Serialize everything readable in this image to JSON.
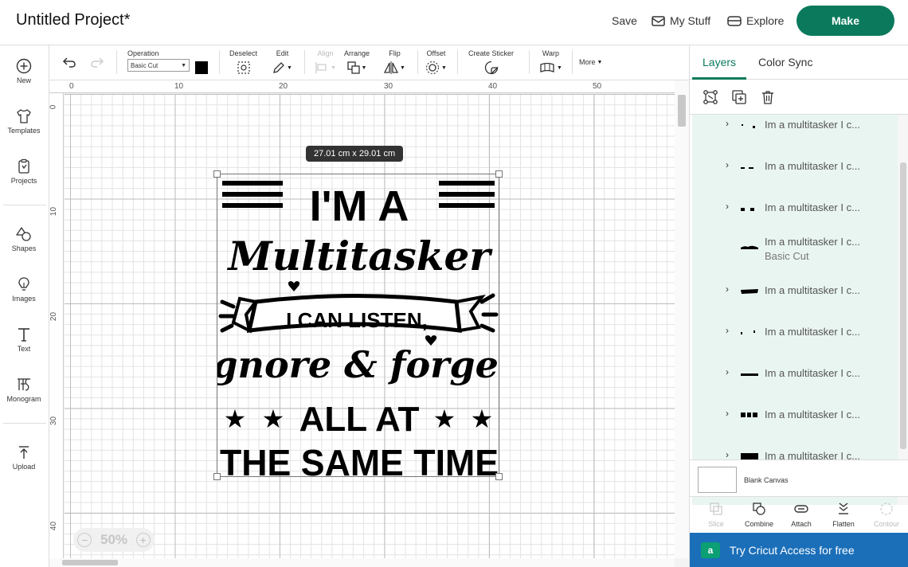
{
  "header": {
    "title": "Untitled Project*",
    "save_label": "Save",
    "my_stuff_label": "My Stuff",
    "explore_label": "Explore",
    "make_label": "Make"
  },
  "sidebar": {
    "items": [
      {
        "label": "New",
        "icon": "plus-circle-icon"
      },
      {
        "label": "Templates",
        "icon": "shirt-icon"
      },
      {
        "label": "Projects",
        "icon": "clipboard-icon"
      },
      {
        "label": "Shapes",
        "icon": "shapes-icon"
      },
      {
        "label": "Images",
        "icon": "lightbulb-icon"
      },
      {
        "label": "Text",
        "icon": "text-icon"
      },
      {
        "label": "Monogram",
        "icon": "monogram-icon"
      },
      {
        "label": "Upload",
        "icon": "upload-icon"
      }
    ]
  },
  "toolbar": {
    "operation_label": "Operation",
    "operation_value": "Basic Cut",
    "deselect_label": "Deselect",
    "edit_label": "Edit",
    "align_label": "Align",
    "arrange_label": "Arrange",
    "flip_label": "Flip",
    "offset_label": "Offset",
    "create_sticker_label": "Create Sticker",
    "warp_label": "Warp",
    "more_label": "More"
  },
  "canvas": {
    "size_tooltip": "27.01  cm x 29.01  cm",
    "ruler_top": [
      "0",
      "10",
      "20",
      "30",
      "40",
      "50"
    ],
    "ruler_left": [
      "0",
      "10",
      "20",
      "30",
      "40"
    ],
    "zoom": "50%",
    "design_lines": [
      "I'M A",
      "Multitasker",
      "I CAN LISTEN,",
      "ignore & forget",
      "ALL AT",
      "THE SAME TIME"
    ]
  },
  "panel": {
    "tab_layers": "Layers",
    "tab_color_sync": "Color Sync",
    "layers": [
      {
        "name": "Im a multitasker I c...",
        "sub": "",
        "expandable": true
      },
      {
        "name": "Im a multitasker I c...",
        "sub": "",
        "expandable": true
      },
      {
        "name": "Im a multitasker I c...",
        "sub": "",
        "expandable": true
      },
      {
        "name": "Im a multitasker I c...",
        "sub": "Basic Cut",
        "expandable": false
      },
      {
        "name": "Im a multitasker I c...",
        "sub": "",
        "expandable": true
      },
      {
        "name": "Im a multitasker I c...",
        "sub": "",
        "expandable": true
      },
      {
        "name": "Im a multitasker I c...",
        "sub": "",
        "expandable": true
      },
      {
        "name": "Im a multitasker I c...",
        "sub": "",
        "expandable": true
      },
      {
        "name": "Im a multitasker I c...",
        "sub": "",
        "expandable": true
      }
    ],
    "blank_canvas_label": "Blank Canvas",
    "bottom_tools": [
      "Slice",
      "Combine",
      "Attach",
      "Flatten",
      "Contour"
    ],
    "access_label": "Try Cricut Access for free",
    "access_icon_letter": "a"
  },
  "colors": {
    "accent": "#0b7a5c",
    "access_banner": "#1b6fb9",
    "layers_bg": "#e9f5f1"
  }
}
